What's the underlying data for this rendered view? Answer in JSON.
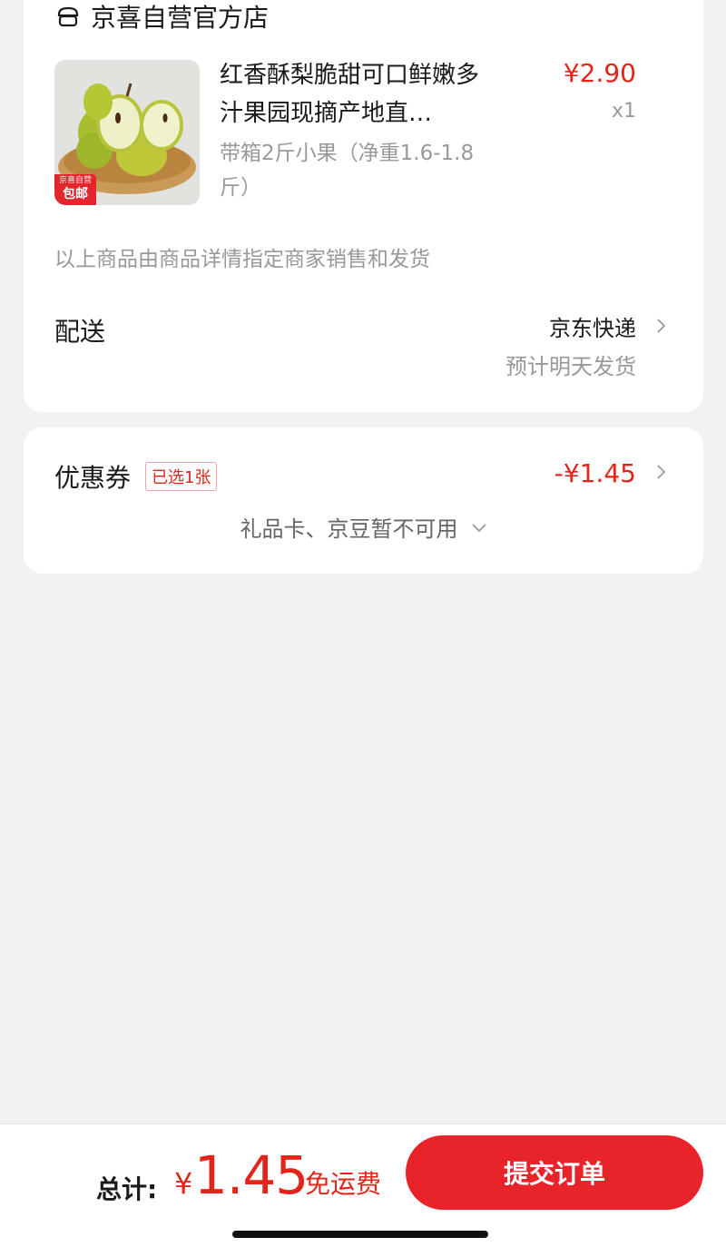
{
  "store": {
    "name": "京喜自营官方店",
    "icon": "store-icon"
  },
  "product": {
    "title": "红香酥梨脆甜可口鲜嫩多汁果园现摘产地直…",
    "spec": "带箱2斤小果（净重1.6-1.8斤）",
    "price": "¥2.90",
    "quantity": "x1",
    "badge_top": "京喜自营",
    "badge_bottom": "包邮"
  },
  "seller_note": "以上商品由商品详情指定商家销售和发货",
  "delivery": {
    "label": "配送",
    "method": "京东快递",
    "eta": "预计明天发货"
  },
  "coupon": {
    "label": "优惠券",
    "tag": "已选1张",
    "amount": "-¥1.45"
  },
  "gift_card": {
    "text": "礼品卡、京豆暂不可用"
  },
  "footer": {
    "total_label": "总计:",
    "currency": "¥",
    "total": "1.45",
    "shipping": "免运费",
    "submit_label": "提交订单"
  },
  "colors": {
    "accent": "#e1251b",
    "page_bg": "#f2f2f2",
    "muted_text": "#999999"
  }
}
